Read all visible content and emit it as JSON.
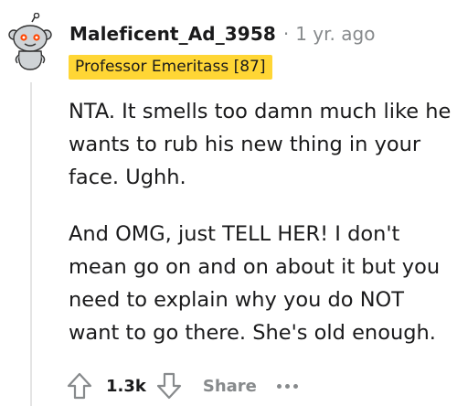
{
  "comment": {
    "username": "Maleficent_Ad_3958",
    "separator": "·",
    "timestamp": "1 yr. ago",
    "flair": "Professor Emeritass [87]",
    "paragraphs": [
      "NTA. It smells too damn much like he wants to rub his new thing in your face. Ughh.",
      "And OMG, just TELL HER! I don't mean go on and on about it but you need to explain why you do NOT want to go there. She's old enough."
    ],
    "avatar_icon": "snoo-avatar-icon"
  },
  "actions": {
    "upvote_icon": "upvote-arrow-icon",
    "score": "1.3k",
    "downvote_icon": "downvote-arrow-icon",
    "share_label": "Share",
    "more_icon": "more-options-icon"
  },
  "colors": {
    "flair_bg": "#ffd635",
    "muted_text": "#878a8c",
    "text": "#1a1a1b"
  }
}
